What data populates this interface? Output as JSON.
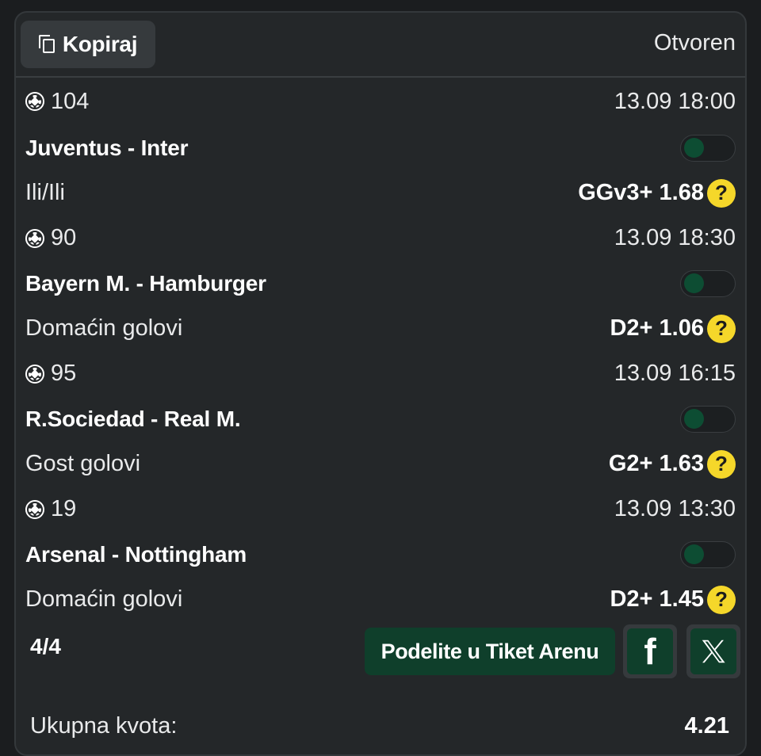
{
  "header": {
    "copy_label": "Kopiraj",
    "status": "Otvoren"
  },
  "events": [
    {
      "code": "104",
      "datetime": "13.09 18:00",
      "teams": "Juventus - Inter",
      "market": "Ili/Ili",
      "pick": "GGv3+ 1.68"
    },
    {
      "code": "90",
      "datetime": "13.09 18:30",
      "teams": "Bayern M. - Hamburger",
      "market": "Domaćin golovi",
      "pick": "D2+ 1.06"
    },
    {
      "code": "95",
      "datetime": "13.09 16:15",
      "teams": "R.Sociedad - Real M.",
      "market": "Gost golovi",
      "pick": "G2+ 1.63"
    },
    {
      "code": "19",
      "datetime": "13.09 13:30",
      "teams": "Arsenal - Nottingham",
      "market": "Domaćin golovi",
      "pick": "D2+ 1.45"
    }
  ],
  "help_glyph": "?",
  "footer": {
    "count": "4/4",
    "share_label": "Podelite u Tiket Arenu",
    "facebook_glyph": "f",
    "total_label": "Ukupna kvota:",
    "total_value": "4.21"
  },
  "colors": {
    "background": "#1b1d1f",
    "card": "#242729",
    "accent_green": "#0f3f2b",
    "help_yellow": "#f5d72a"
  },
  "icons": {
    "copy": "copy-icon",
    "sport": "soccer-ball-icon",
    "help": "question-circle-icon",
    "facebook": "facebook-icon",
    "x": "x-twitter-icon"
  }
}
